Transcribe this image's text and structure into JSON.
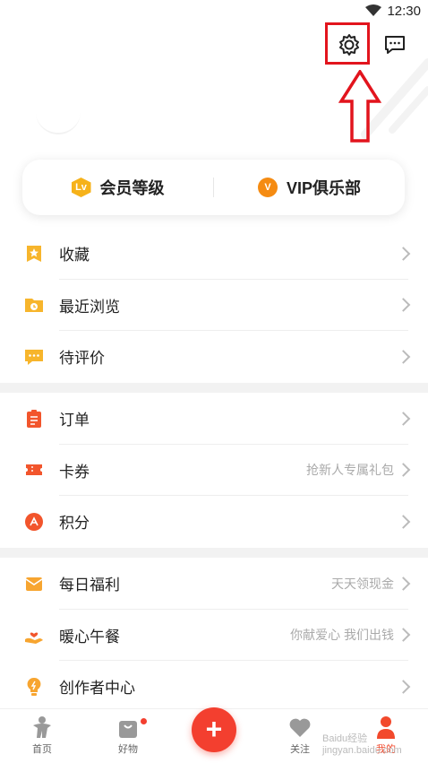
{
  "status": {
    "time": "12:30"
  },
  "colors": {
    "accent": "#f33f2f",
    "highlight": "#e2141d"
  },
  "header": {
    "settings_icon": "gear-icon",
    "message_icon": "chat-icon"
  },
  "membership": {
    "level_badge": "Lv",
    "level_label": "会员等级",
    "vip_badge": "V",
    "vip_label": "VIP俱乐部"
  },
  "group1": [
    {
      "label": "收藏",
      "hint": ""
    },
    {
      "label": "最近浏览",
      "hint": ""
    },
    {
      "label": "待评价",
      "hint": ""
    }
  ],
  "group2": [
    {
      "label": "订单",
      "hint": ""
    },
    {
      "label": "卡券",
      "hint": "抢新人专属礼包"
    },
    {
      "label": "积分",
      "hint": ""
    }
  ],
  "group3": [
    {
      "label": "每日福利",
      "hint": "天天领现金"
    },
    {
      "label": "暖心午餐",
      "hint": "你献爱心 我们出钱"
    },
    {
      "label": "创作者中心",
      "hint": ""
    }
  ],
  "tabs": [
    {
      "label": "首页"
    },
    {
      "label": "好物"
    },
    {
      "label": "+"
    },
    {
      "label": "关注"
    },
    {
      "label": "我的"
    }
  ],
  "watermark": "Baidu经验 jingyan.baidu.com"
}
